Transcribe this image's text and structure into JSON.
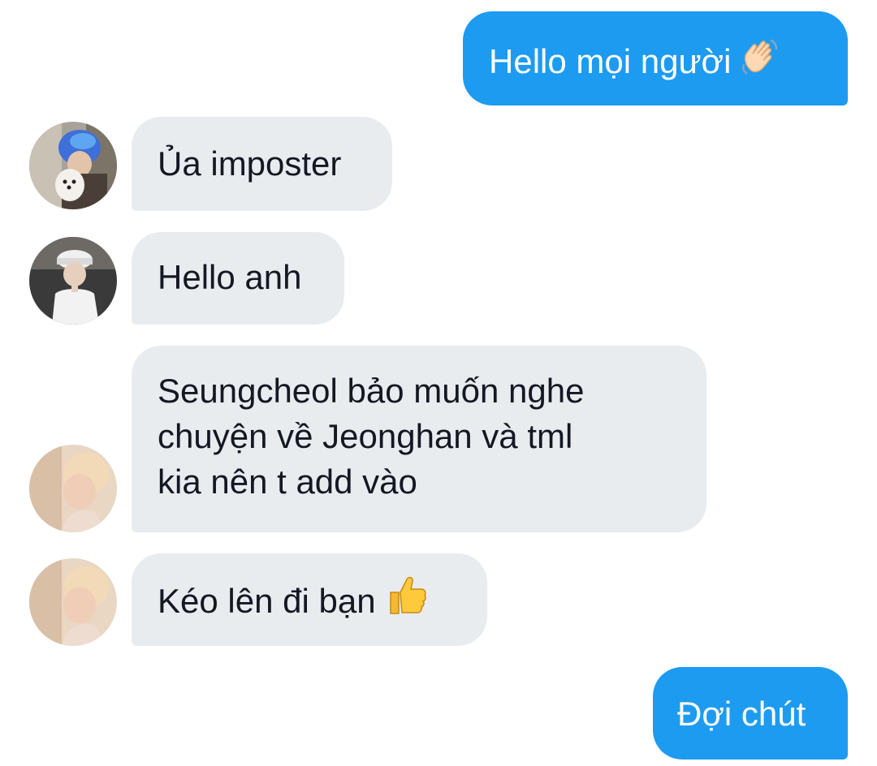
{
  "messages": [
    {
      "id": "m1",
      "direction": "outgoing",
      "text": "Hello mọi người",
      "emoji": "waving-hand"
    },
    {
      "id": "m2",
      "direction": "incoming",
      "sender_avatar": "avatar-blue-hair-with-dog",
      "text": "Ủa imposter"
    },
    {
      "id": "m3",
      "direction": "incoming",
      "sender_avatar": "avatar-white-cap",
      "text": "Hello anh"
    },
    {
      "id": "m4",
      "direction": "incoming",
      "sender_avatar": "avatar-blonde-hair",
      "lines": [
        "Seungcheol bảo muốn nghe",
        "chuyện về Jeonghan và tml",
        "kia nên t add vào"
      ]
    },
    {
      "id": "m5",
      "direction": "incoming",
      "sender_avatar": "avatar-blonde-hair",
      "text": "Kéo lên đi bạn",
      "emoji": "thumbs-up"
    },
    {
      "id": "m6",
      "direction": "outgoing",
      "text": "Đợi chút"
    }
  ],
  "colors": {
    "outgoing_bubble": "#1d9bf0",
    "incoming_bubble": "#e9ecef",
    "incoming_text": "#141823",
    "outgoing_text": "#ffffff"
  }
}
